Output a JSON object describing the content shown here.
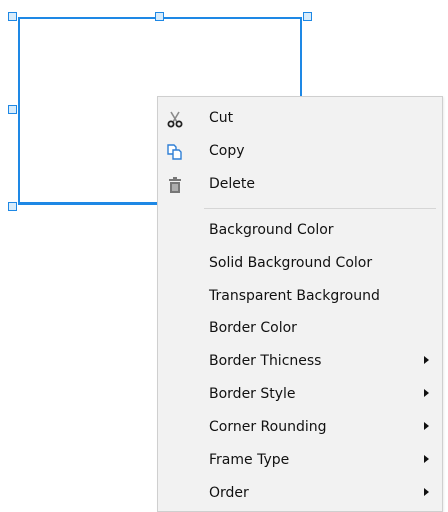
{
  "colors": {
    "selection": "#1e88e5",
    "menu_background": "#f2f2f2",
    "copy_icon": "#2f7fd6"
  },
  "context_menu": {
    "items": [
      {
        "label": "Cut",
        "icon": "scissors-icon"
      },
      {
        "label": "Copy",
        "icon": "copy-icon"
      },
      {
        "label": "Delete",
        "icon": "trash-icon"
      },
      {
        "label": "Background Color"
      },
      {
        "label": "Solid Background Color"
      },
      {
        "label": "Transparent Background"
      },
      {
        "label": "Border Color"
      },
      {
        "label": "Border Thicness",
        "submenu": true
      },
      {
        "label": "Border Style",
        "submenu": true
      },
      {
        "label": "Corner Rounding",
        "submenu": true
      },
      {
        "label": "Frame Type",
        "submenu": true
      },
      {
        "label": "Order",
        "submenu": true
      }
    ]
  }
}
